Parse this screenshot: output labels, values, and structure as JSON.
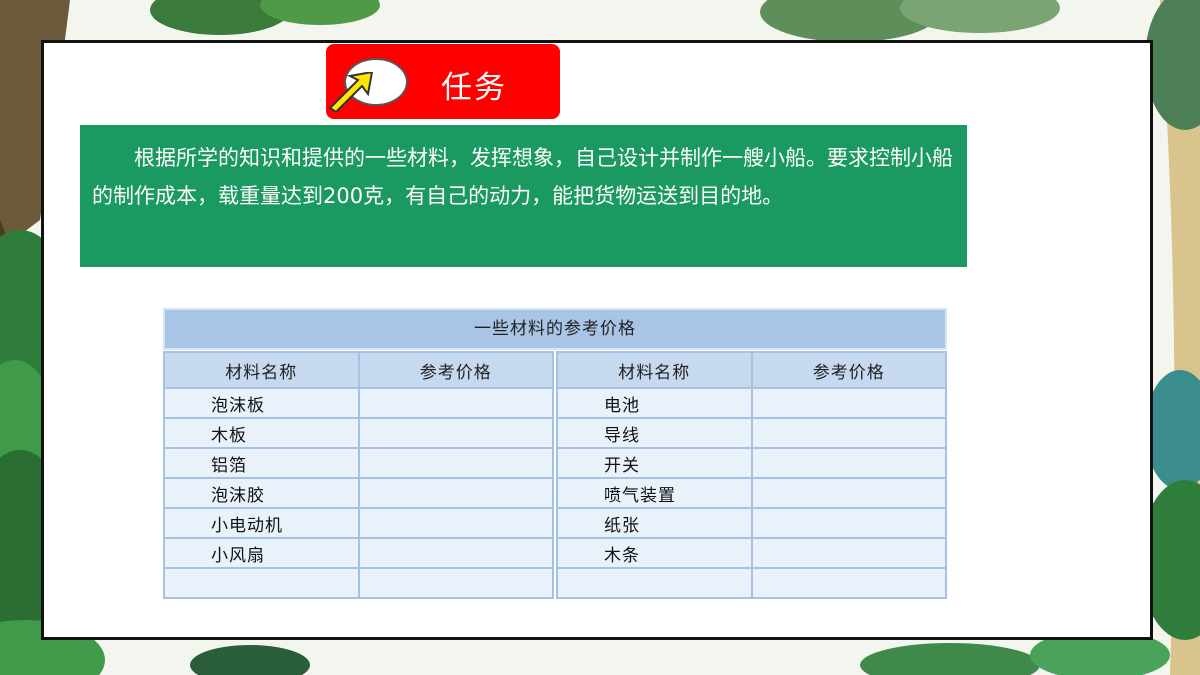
{
  "task": {
    "label": "任务"
  },
  "description": {
    "text": "根据所学的知识和提供的一些材料，发挥想象，自己设计并制作一艘小船。要求控制小船的制作成本，载重量达到200克，有自己的动力，能把货物运送到目的地。"
  },
  "table": {
    "title": "一些材料的参考价格",
    "left": {
      "headers": [
        "材料名称",
        "参考价格"
      ],
      "rows": [
        "泡沫板",
        "木板",
        "铝箔",
        "泡沫胶",
        "小电动机",
        "小风扇",
        ""
      ]
    },
    "right": {
      "headers": [
        "材料名称",
        "参考价格"
      ],
      "rows": [
        "电池",
        "导线",
        "开关",
        "喷气装置",
        "纸张",
        "木条",
        ""
      ]
    }
  },
  "colors": {
    "task_red": "#ff0000",
    "desc_green": "#1a9960",
    "table_title": "#a9c5e6",
    "table_header": "#c6d9ef",
    "table_cell": "#e9f1fa"
  }
}
